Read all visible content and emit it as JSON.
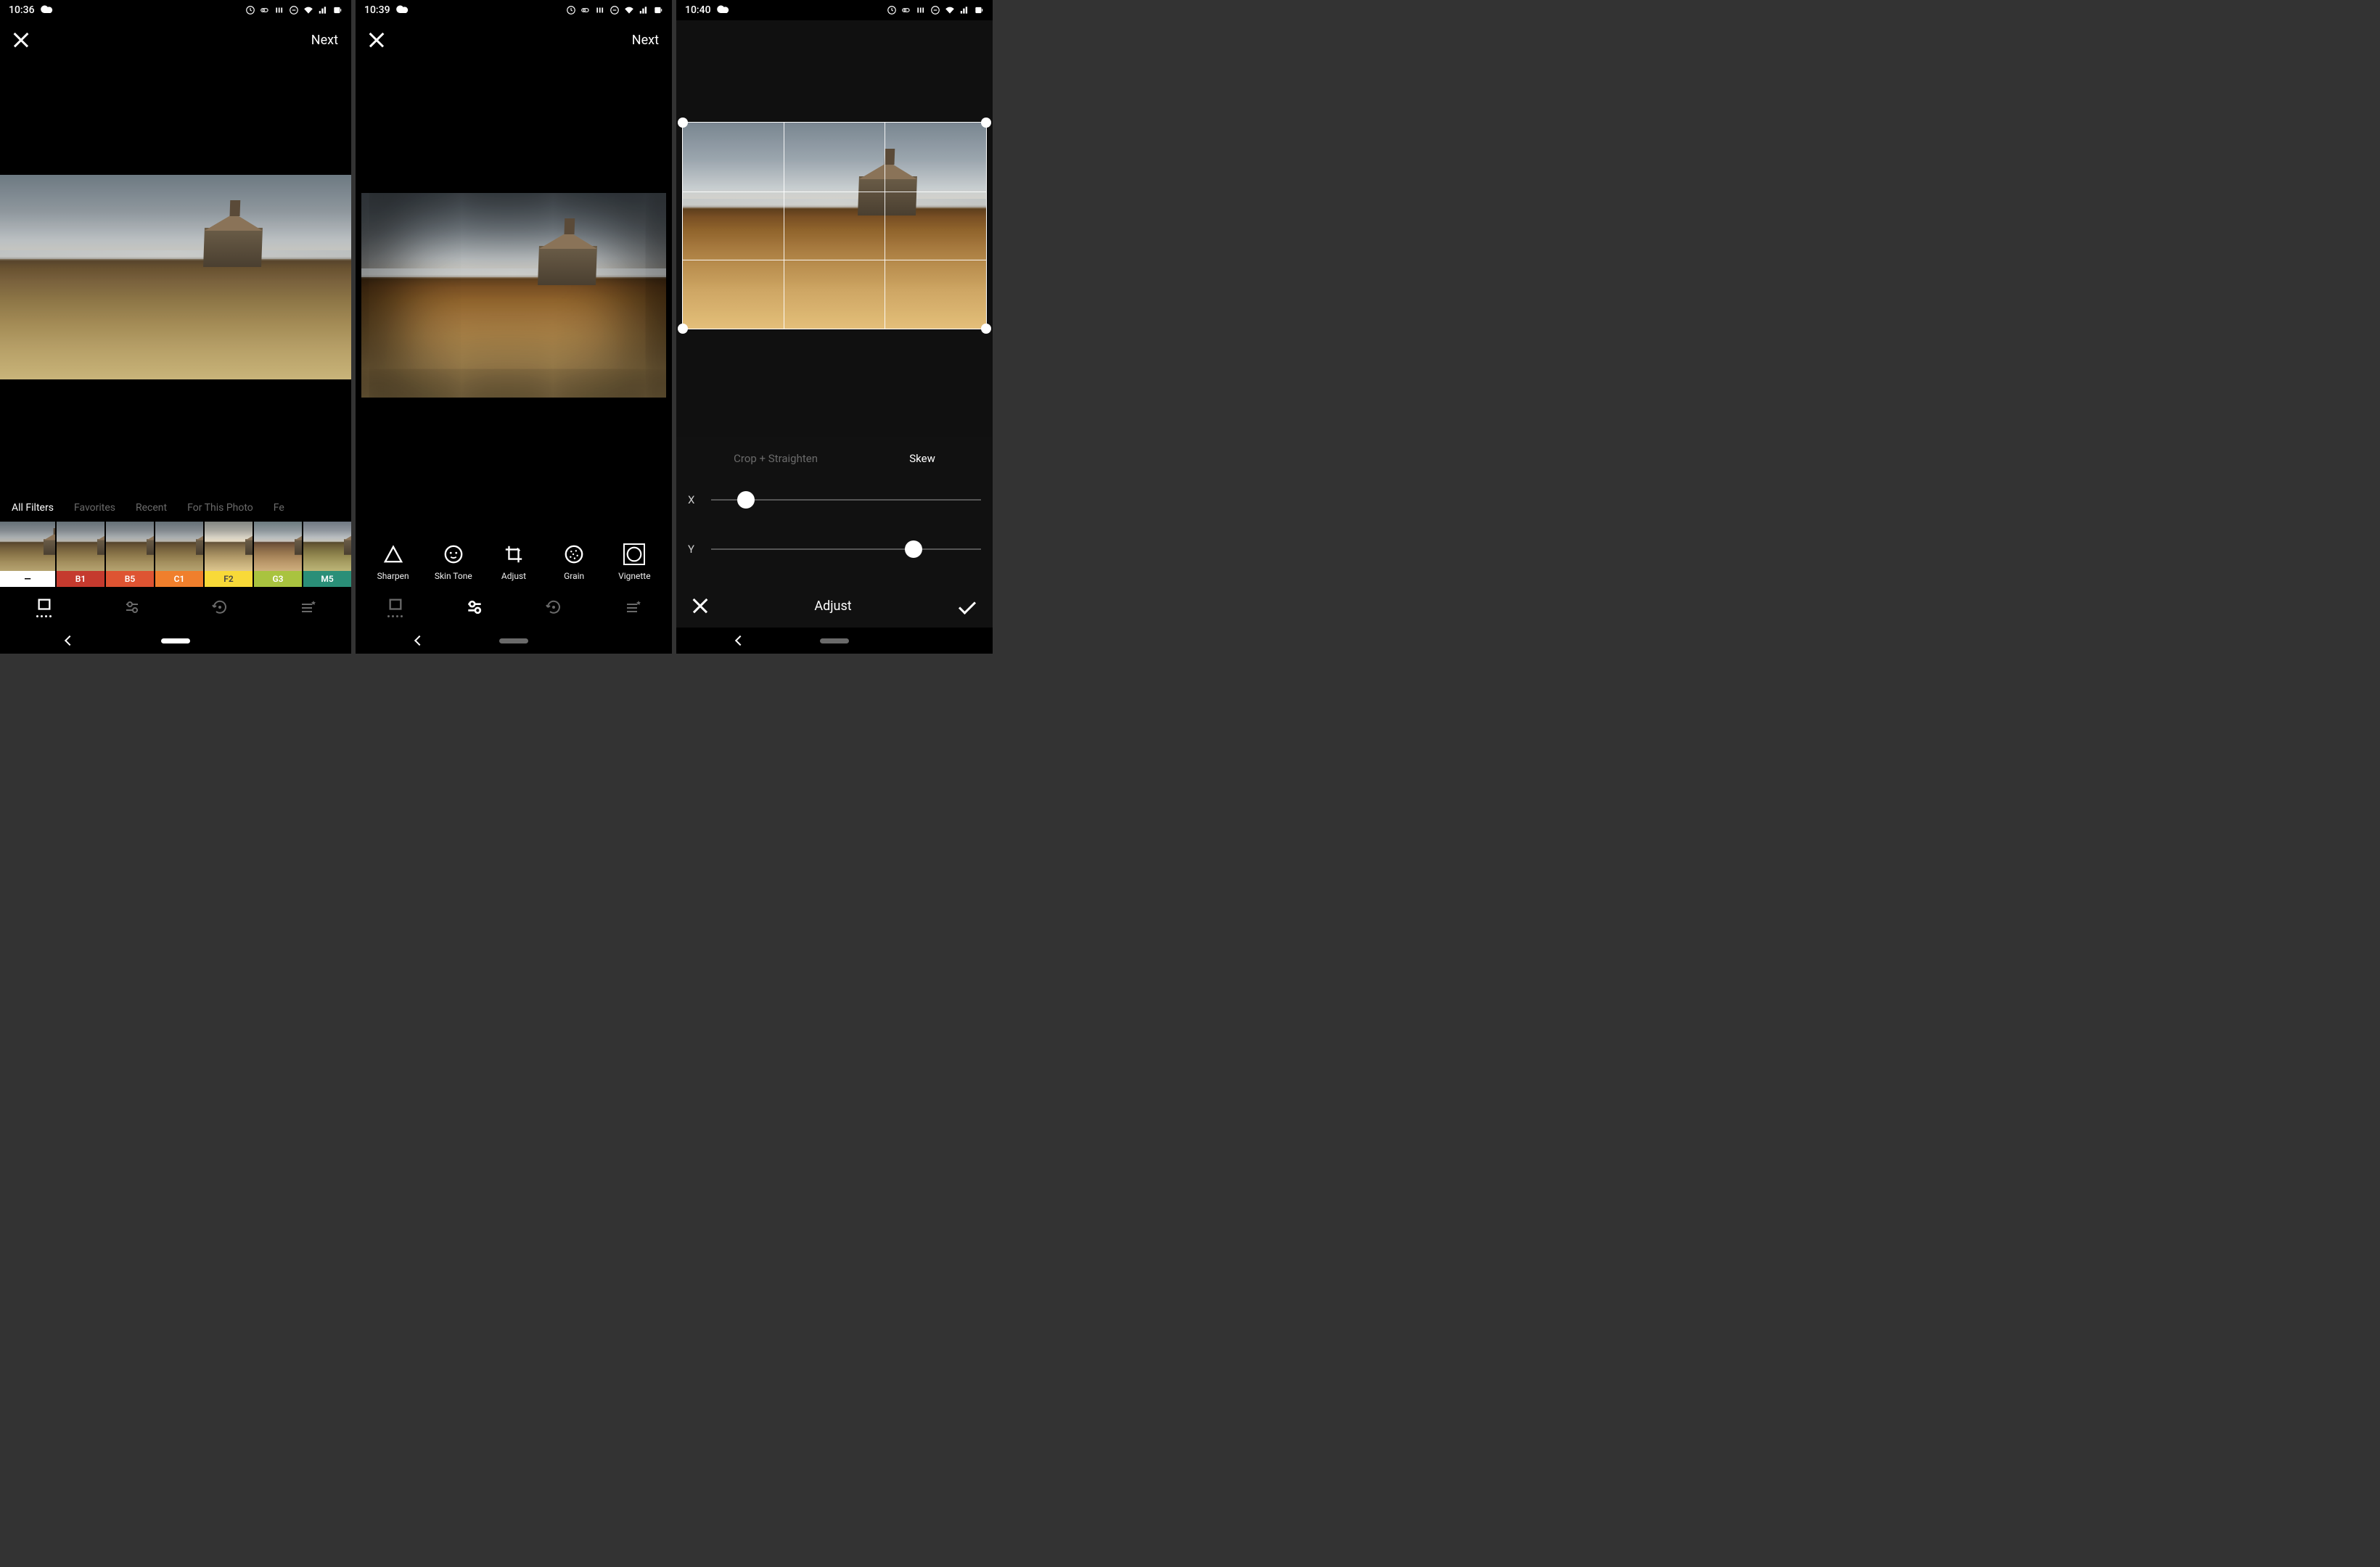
{
  "screens": [
    {
      "status_time": "10:36",
      "next_label": "Next",
      "filter_categories": [
        "All Filters",
        "Favorites",
        "Recent",
        "For This Photo",
        "Fe"
      ],
      "filter_categories_active": 0,
      "filter_thumbs": [
        {
          "label": "—",
          "bg": "#ffffff",
          "fg": "#000"
        },
        {
          "label": "B1",
          "bg": "#c53a2e",
          "bw": true
        },
        {
          "label": "B5",
          "bg": "#de5432"
        },
        {
          "label": "C1",
          "bg": "#f07f2c"
        },
        {
          "label": "F2",
          "bg": "#f8d938",
          "fg": "#444"
        },
        {
          "label": "G3",
          "bg": "#a9c33f"
        },
        {
          "label": "M5",
          "bg": "#2a8f78"
        }
      ]
    },
    {
      "status_time": "10:39",
      "next_label": "Next",
      "tools": [
        {
          "label": "Sharpen",
          "icon": "triangle"
        },
        {
          "label": "Skin Tone",
          "icon": "face"
        },
        {
          "label": "Adjust",
          "icon": "crop"
        },
        {
          "label": "Grain",
          "icon": "grain"
        },
        {
          "label": "Vignette",
          "icon": "vignette",
          "selected": true
        }
      ]
    },
    {
      "status_time": "10:40",
      "adjust_tabs": [
        "Crop + Straighten",
        "Skew"
      ],
      "adjust_tabs_active": 1,
      "sliders": [
        {
          "axis": "X",
          "pos": 13
        },
        {
          "axis": "Y",
          "pos": 75
        }
      ],
      "adjust_title": "Adjust"
    }
  ]
}
